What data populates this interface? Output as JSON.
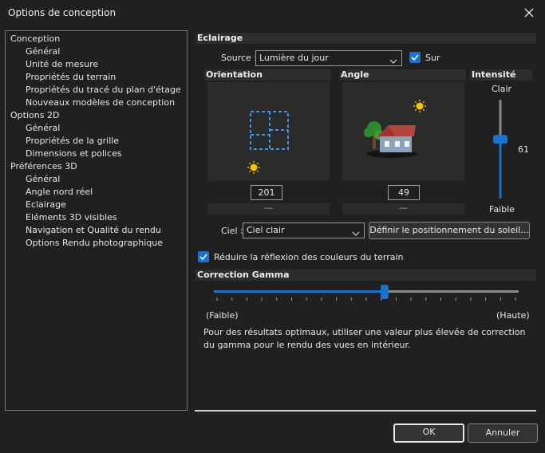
{
  "window": {
    "title": "Options de conception"
  },
  "tree": {
    "items": [
      {
        "label": "Conception",
        "level": 0
      },
      {
        "label": "Général",
        "level": 1
      },
      {
        "label": "Unité de mesure",
        "level": 1
      },
      {
        "label": "Propriétés du terrain",
        "level": 1
      },
      {
        "label": "Propriétés du tracé du plan d'étage",
        "level": 1
      },
      {
        "label": "Nouveaux modèles de conception",
        "level": 1
      },
      {
        "label": "Options 2D",
        "level": 0
      },
      {
        "label": "Général",
        "level": 1
      },
      {
        "label": "Propriétés de la grille",
        "level": 1
      },
      {
        "label": "Dimensions et polices",
        "level": 1
      },
      {
        "label": "Préférences 3D",
        "level": 0
      },
      {
        "label": "Général",
        "level": 1
      },
      {
        "label": "Angle nord réel",
        "level": 1
      },
      {
        "label": "Eclairage",
        "level": 1
      },
      {
        "label": "Eléments 3D visibles",
        "level": 1
      },
      {
        "label": "Navigation et Qualité du rendu",
        "level": 1
      },
      {
        "label": "Options Rendu photographique",
        "level": 1
      }
    ]
  },
  "lighting": {
    "header": "Eclairage",
    "source_label": "Source :",
    "source_value": "Lumière du jour",
    "on_label": "Sur",
    "on_checked": true,
    "orientation": {
      "header": "Orientation",
      "value": "201",
      "bar": "—"
    },
    "angle": {
      "header": "Angle",
      "value": "49",
      "bar": "—"
    },
    "intensity": {
      "header": "Intensité",
      "high": "Clair",
      "low": "Faible",
      "value": "61",
      "level": 61
    },
    "sky_label": "Ciel :",
    "sky_value": "Ciel clair",
    "sun_button": "Définir le positionnement du soleil..."
  },
  "terrain": {
    "label": "Réduire la réflexion des couleurs du terrain",
    "checked": true
  },
  "gamma": {
    "header": "Correction Gamma",
    "low_label": "(Faible)",
    "high_label": "(Haute)",
    "position": 0.56,
    "hint": "Pour des résultats optimaux, utiliser une valeur plus élevée de correction du gamma pour le rendu des vues en intérieur."
  },
  "buttons": {
    "ok": "OK",
    "cancel": "Annuler"
  },
  "colors": {
    "accent": "#1a73c9",
    "sun": "#f2c500"
  }
}
